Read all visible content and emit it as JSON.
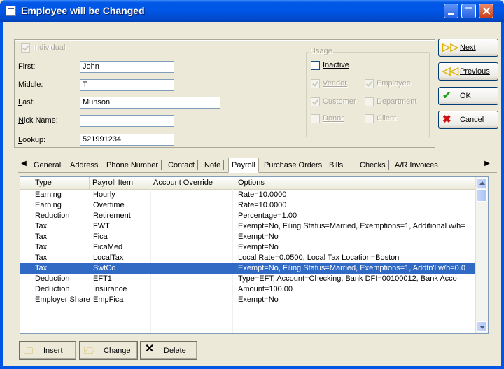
{
  "window": {
    "title": "Employee will be Changed"
  },
  "form": {
    "individual_label": "Individual",
    "first_label": "First:",
    "first_value": "John",
    "middle_label": "Middle:",
    "middle_value": "T",
    "last_label": "Last:",
    "last_value": "Munson",
    "nick_label": "Nick Name:",
    "nick_value": "",
    "lookup_label": "Lookup:",
    "lookup_value": "521991234"
  },
  "usage": {
    "title": "Usage",
    "inactive": "Inactive",
    "vendor": "Vendor",
    "employee": "Employee",
    "customer": "Customer",
    "department": "Department",
    "donor": "Donor",
    "client": "Client"
  },
  "buttons": {
    "next": "Next",
    "previous": "Previous",
    "ok": "OK",
    "cancel": "Cancel"
  },
  "tabs": [
    {
      "label": "General"
    },
    {
      "label": "Address"
    },
    {
      "label": "Phone Number"
    },
    {
      "label": "Contact"
    },
    {
      "label": "Note"
    },
    {
      "label": "Payroll"
    },
    {
      "label": "Purchase Orders"
    },
    {
      "label": "Bills"
    },
    {
      "label": "Checks"
    },
    {
      "label": "A/R Invoices"
    }
  ],
  "columns": [
    "Type",
    "Payroll Item",
    "Account Override",
    "Options"
  ],
  "rows": [
    {
      "type": "Earning",
      "item": "Hourly",
      "account": "",
      "options": "Rate=10.0000"
    },
    {
      "type": "Earning",
      "item": "Overtime",
      "account": "",
      "options": "Rate=10.0000"
    },
    {
      "type": "Reduction",
      "item": "Retirement",
      "account": "",
      "options": "Percentage=1.00"
    },
    {
      "type": "Tax",
      "item": "FWT",
      "account": "",
      "options": "Exempt=No, Filing Status=Married, Exemptions=1, Additional w/h="
    },
    {
      "type": "Tax",
      "item": "Fica",
      "account": "",
      "options": "Exempt=No"
    },
    {
      "type": "Tax",
      "item": "FicaMed",
      "account": "",
      "options": "Exempt=No"
    },
    {
      "type": "Tax",
      "item": "LocalTax",
      "account": "",
      "options": "Local Rate=0.0500, Local Tax Location=Boston"
    },
    {
      "type": "Tax",
      "item": "SwtCo",
      "account": "",
      "options": "Exempt=No, Filing Status=Married, Exemptions=1, Addtn'l w/h=0.0"
    },
    {
      "type": "Deduction",
      "item": "EFT1",
      "account": "",
      "options": "Type=EFT, Account=Checking, Bank DFI=00100012, Bank Acco"
    },
    {
      "type": "Deduction",
      "item": "Insurance",
      "account": "",
      "options": "Amount=100.00"
    },
    {
      "type": "Employer Share",
      "item": "EmpFica",
      "account": "",
      "options": "Exempt=No"
    }
  ],
  "actions": {
    "insert": "Insert",
    "change": "Change",
    "delete": "Delete"
  },
  "colors": {
    "titlebar": "#0055E5",
    "selection": "#316AC5"
  }
}
